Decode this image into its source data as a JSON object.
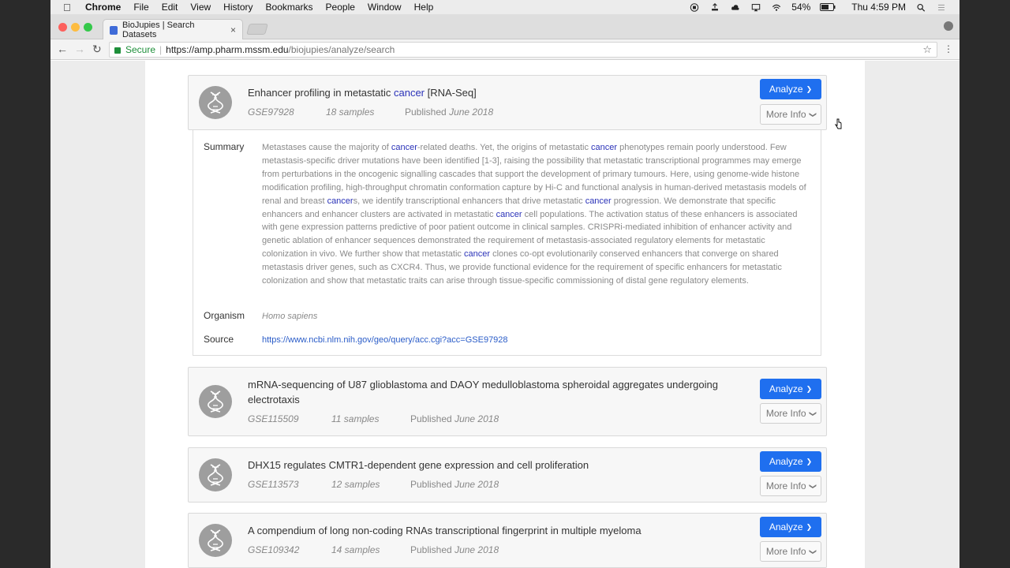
{
  "menubar": {
    "app": "Chrome",
    "items": [
      "File",
      "Edit",
      "View",
      "History",
      "Bookmarks",
      "People",
      "Window",
      "Help"
    ],
    "battery": "54%",
    "clock": "Thu 4:59 PM"
  },
  "browser": {
    "tab_title": "BioJupies | Search Datasets",
    "tab_close": "×",
    "secure_label": "Secure",
    "url_scheme_host": "https://amp.pharm.mssm.edu",
    "url_path": "/biojupies/analyze/search"
  },
  "colors": {
    "analyze": "#1f6fef",
    "highlight": "#2a32b8",
    "link": "#2a5cc8",
    "secure": "#1e8f3a"
  },
  "buttons": {
    "analyze": "Analyze",
    "more_info": "More Info"
  },
  "labels": {
    "published": "Published",
    "summary": "Summary",
    "organism": "Organism",
    "source": "Source"
  },
  "datasets": [
    {
      "title_pre": "Enhancer profiling in metastatic ",
      "title_hl": "cancer",
      "title_post": " [RNA-Seq]",
      "accession": "GSE97928",
      "samples": "18 samples",
      "date": "June 2018"
    },
    {
      "title": "mRNA-sequencing of U87 glioblastoma and DAOY medulloblastoma spheroidal aggregates undergoing electrotaxis",
      "accession": "GSE115509",
      "samples": "11 samples",
      "date": "June 2018"
    },
    {
      "title": "DHX15 regulates CMTR1-dependent gene expression and cell proliferation",
      "accession": "GSE113573",
      "samples": "12 samples",
      "date": "June 2018"
    },
    {
      "title": "A compendium of long non-coding RNAs transcriptional fingerprint in multiple myeloma",
      "accession": "GSE109342",
      "samples": "14 samples",
      "date": "June 2018"
    }
  ],
  "details": {
    "summary_parts": [
      "Metastases cause the majority of ",
      "cancer",
      "-related deaths. Yet, the origins of metastatic ",
      "cancer",
      " phenotypes remain poorly understood. Few metastasis-specific driver mutations have been identified [1-3], raising the possibility that metastatic transcriptional programmes may emerge from perturbations in the oncogenic signalling cascades that support the development of primary tumours. Here, using genome-wide histone modification profiling, high-throughput chromatin conformation capture by Hi-C and functional analysis in human-derived metastasis models of renal and breast ",
      "cancer",
      "s, we identify transcriptional enhancers that drive metastatic ",
      "cancer",
      " progression. We demonstrate that specific enhancers and enhancer clusters are activated in metastatic ",
      "cancer",
      " cell populations. The activation status of these enhancers is associated with gene expression patterns predictive of poor patient outcome in clinical samples. CRISPRi-mediated inhibition of enhancer activity and genetic ablation of enhancer sequences demonstrated the requirement of metastasis-associated regulatory elements for metastatic colonization in vivo. We further show that metastatic ",
      "cancer",
      " clones co-opt evolutionarily conserved enhancers that converge on shared metastasis driver genes, such as CXCR4. Thus, we provide functional evidence for the requirement of specific enhancers for metastatic colonization and show that metastatic traits can arise through tissue-specific commissioning of distal gene regulatory elements."
    ],
    "organism": "Homo sapiens",
    "source_url": "https://www.ncbi.nlm.nih.gov/geo/query/acc.cgi?acc=GSE97928"
  }
}
